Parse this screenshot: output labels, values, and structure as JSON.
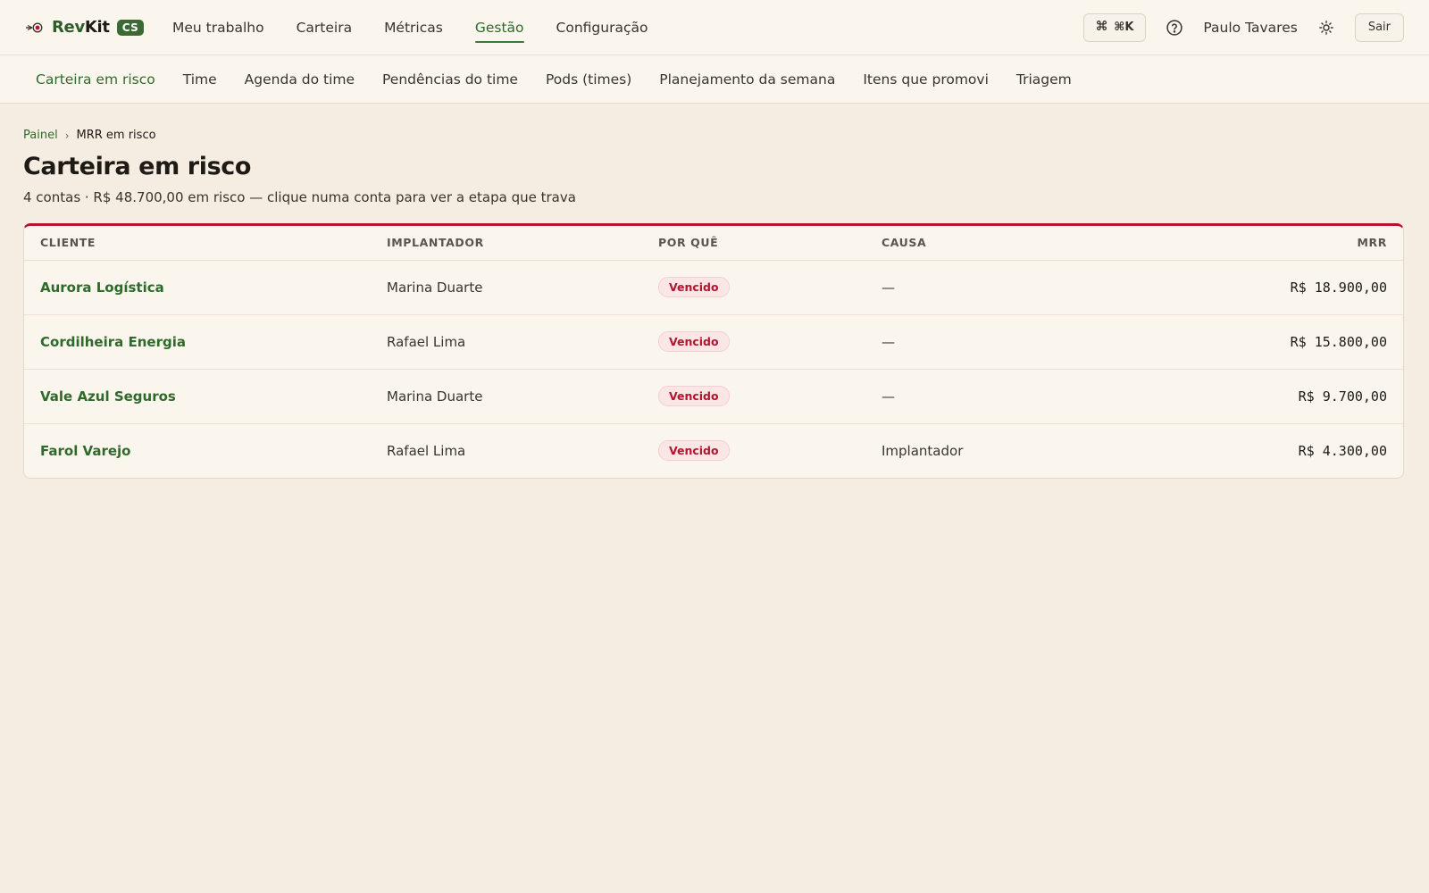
{
  "header": {
    "brand_name_a": "Rev",
    "brand_name_b": "Kit",
    "brand_badge": "CS",
    "nav": [
      {
        "label": "Meu trabalho",
        "active": false
      },
      {
        "label": "Carteira",
        "active": false
      },
      {
        "label": "Métricas",
        "active": false
      },
      {
        "label": "Gestão",
        "active": true
      },
      {
        "label": "Configuração",
        "active": false
      }
    ],
    "shortcut_label": "⌘K",
    "user_name": "Paulo Tavares",
    "logout_label": "Sair"
  },
  "subnav": [
    {
      "label": "Carteira em risco",
      "active": true
    },
    {
      "label": "Time",
      "active": false
    },
    {
      "label": "Agenda do time",
      "active": false
    },
    {
      "label": "Pendências do time",
      "active": false
    },
    {
      "label": "Pods (times)",
      "active": false
    },
    {
      "label": "Planejamento da semana",
      "active": false
    },
    {
      "label": "Itens que promovi",
      "active": false
    },
    {
      "label": "Triagem",
      "active": false
    }
  ],
  "breadcrumb": {
    "root": "Painel",
    "separator": "›",
    "current": "MRR em risco"
  },
  "page": {
    "title": "Carteira em risco",
    "subtitle": "4 contas · R$ 48.700,00 em risco — clique numa conta para ver a etapa que trava"
  },
  "table": {
    "columns": [
      "CLIENTE",
      "IMPLANTADOR",
      "POR QUÊ",
      "CAUSA",
      "MRR"
    ],
    "rows": [
      {
        "client": "Aurora Logística",
        "implanter": "Marina Duarte",
        "reason": "Vencido",
        "cause": "—",
        "mrr": "R$ 18.900,00"
      },
      {
        "client": "Cordilheira Energia",
        "implanter": "Rafael Lima",
        "reason": "Vencido",
        "cause": "—",
        "mrr": "R$ 15.800,00"
      },
      {
        "client": "Vale Azul Seguros",
        "implanter": "Marina Duarte",
        "reason": "Vencido",
        "cause": "—",
        "mrr": "R$ 9.700,00"
      },
      {
        "client": "Farol Varejo",
        "implanter": "Rafael Lima",
        "reason": "Vencido",
        "cause": "Implantador",
        "mrr": "R$ 4.300,00"
      }
    ]
  },
  "colors": {
    "accent_green": "#2f6a2a",
    "risk_red": "#b3152f",
    "background": "#f5ede1"
  },
  "icons": {
    "logo": "revkit-logo-icon",
    "command": "command-icon",
    "help": "help-circle-icon",
    "theme": "sun-icon"
  }
}
